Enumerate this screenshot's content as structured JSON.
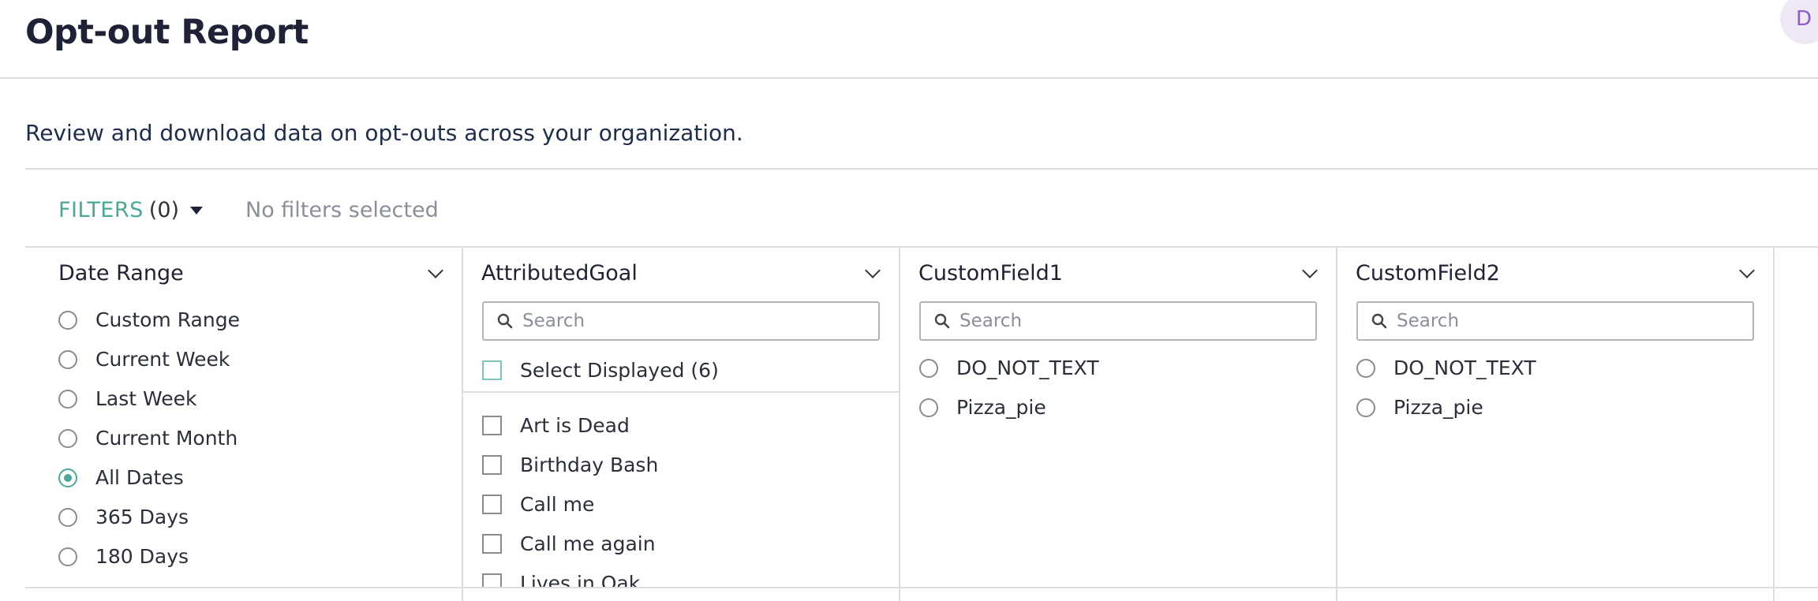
{
  "header": {
    "title": "Opt-out Report",
    "avatar_initial": "D"
  },
  "description": "Review and download data on opt-outs across your organization.",
  "filters": {
    "label": "FILTERS",
    "count": "(0)",
    "summary": "No filters selected"
  },
  "panels": {
    "date_range": {
      "title": "Date Range",
      "options": [
        {
          "label": "Custom Range",
          "selected": false
        },
        {
          "label": "Current Week",
          "selected": false
        },
        {
          "label": "Last Week",
          "selected": false
        },
        {
          "label": "Current Month",
          "selected": false
        },
        {
          "label": "All Dates",
          "selected": true
        },
        {
          "label": "365 Days",
          "selected": false
        },
        {
          "label": "180 Days",
          "selected": false
        }
      ]
    },
    "attributed_goal": {
      "title": "AttributedGoal",
      "search_placeholder": "Search",
      "select_displayed": "Select Displayed (6)",
      "items": [
        "Art is Dead",
        "Birthday Bash",
        "Call me",
        "Call me again",
        "Lives in Oak"
      ]
    },
    "custom_field1": {
      "title": "CustomField1",
      "search_placeholder": "Search",
      "options": [
        "DO_NOT_TEXT",
        "Pizza_pie"
      ]
    },
    "custom_field2": {
      "title": "CustomField2",
      "search_placeholder": "Search",
      "options": [
        "DO_NOT_TEXT",
        "Pizza_pie"
      ]
    }
  },
  "colors": {
    "accent": "#4aa897",
    "title": "#1f2236",
    "avatar_text": "#8a5bd1",
    "avatar_bg": "#efe9f7"
  },
  "icons": [
    "search-icon",
    "chevron-down-icon",
    "caret-down-icon"
  ]
}
